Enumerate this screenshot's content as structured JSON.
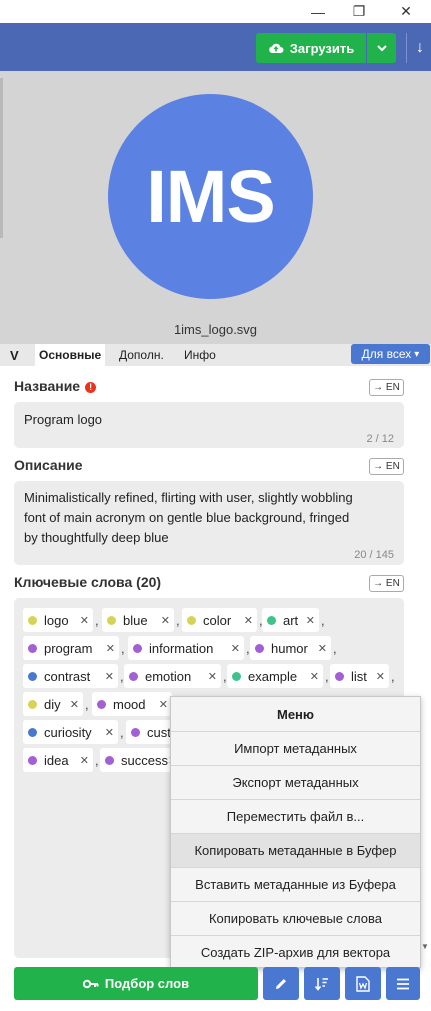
{
  "window": {
    "controls": [
      "minimize",
      "restore",
      "close"
    ],
    "minimize_glyph": "—",
    "restore_glyph": "❐",
    "close_glyph": "✕"
  },
  "toolbar": {
    "upload_label": "Загрузить",
    "upload_icon": "cloud-upload-icon",
    "dropdown_icon": "chevron-down-icon",
    "extra_icon": "down-arrow-icon",
    "extra_glyph": "↓",
    "bg_color": "#4a68b4",
    "button_color": "#22b24c"
  },
  "preview": {
    "logo_text": "IMS",
    "logo_color": "#5b82e2",
    "filename": "1ims_logo.svg"
  },
  "tabs": {
    "logo_glyph": "V",
    "items": [
      "Основные",
      "Дополн.",
      "Инфо"
    ],
    "active": "Основные",
    "scope_label": "Для всех",
    "scope_caret": "▾"
  },
  "form": {
    "en_label": "→ EN",
    "title": {
      "label": "Название",
      "required_glyph": "!",
      "value": "Program logo",
      "counter": "2 / 12"
    },
    "description": {
      "label": "Описание",
      "lines": [
        "Minimalistically refined, flirting with user, slightly wobbling",
        "font of main acronym on gentle blue background, fringed",
        "by thoughtfully deep blue"
      ],
      "counter": "20 / 145"
    },
    "keywords": {
      "label": "Ключевые слова (20)",
      "remove_glyph": "✕",
      "separator": ",",
      "chips": [
        {
          "text": "logo",
          "color": "#d6d455"
        },
        {
          "text": "blue",
          "color": "#d6d455"
        },
        {
          "text": "color",
          "color": "#d6d455"
        },
        {
          "text": "art",
          "color": "#3ec38f"
        },
        {
          "text": "program",
          "color": "#a25fd6"
        },
        {
          "text": "information",
          "color": "#a25fd6"
        },
        {
          "text": "humor",
          "color": "#a25fd6"
        },
        {
          "text": "contrast",
          "color": "#4a78d0"
        },
        {
          "text": "emotion",
          "color": "#a25fd6"
        },
        {
          "text": "example",
          "color": "#3ec38f"
        },
        {
          "text": "list",
          "color": "#a25fd6"
        },
        {
          "text": "diy",
          "color": "#d6d455"
        },
        {
          "text": "mood",
          "color": "#a25fd6"
        },
        {
          "text": "curiosity",
          "color": "#4a78d0"
        },
        {
          "text": "cust",
          "color": "#a25fd6"
        },
        {
          "text": "idea",
          "color": "#a25fd6"
        },
        {
          "text": "success",
          "color": "#a25fd6"
        }
      ]
    }
  },
  "menu": {
    "title": "Меню",
    "items": [
      "Импорт метаданных",
      "Экспорт метаданных",
      "Переместить файл в...",
      "Копировать метаданные в Буфер",
      "Вставить метаданные из Буфера",
      "Копировать ключевые слова",
      "Создать ZIP-архив для вектора"
    ],
    "hovered": "Копировать метаданные в Буфер"
  },
  "bottom": {
    "pick_label": "Подбор слов",
    "pick_icon": "key-icon",
    "icons": [
      "pencil-icon",
      "sort-icon",
      "word-doc-icon",
      "hamburger-menu-icon"
    ]
  }
}
